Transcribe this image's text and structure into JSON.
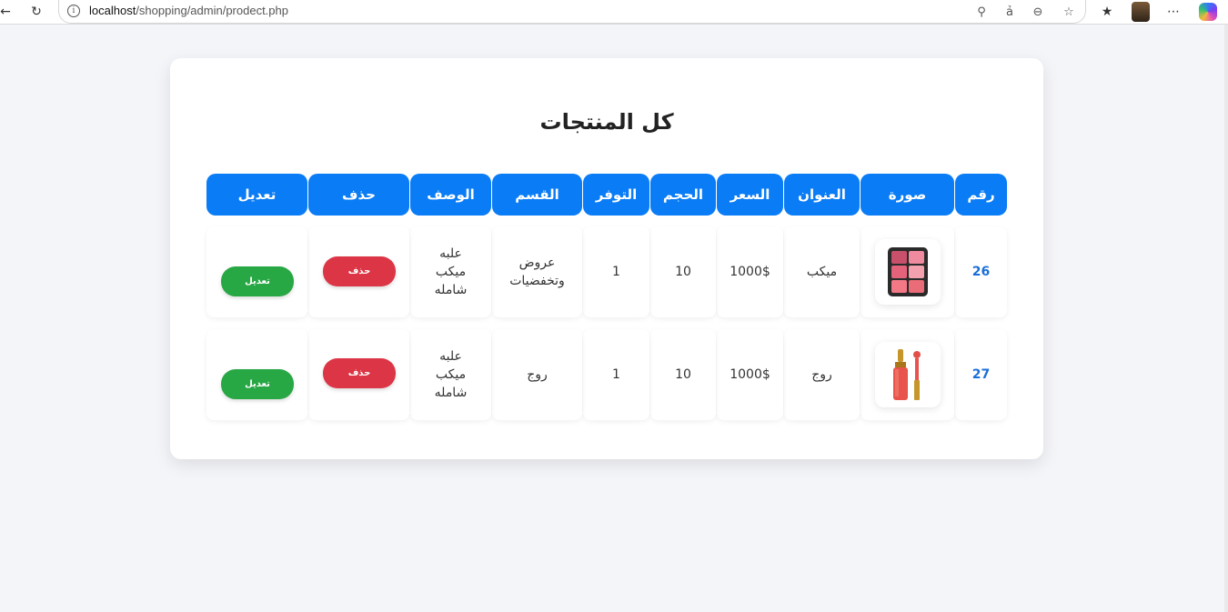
{
  "browser": {
    "url_host": "localhost",
    "url_path": "/shopping/admin/prodect.php"
  },
  "page": {
    "title": "كل المنتجات"
  },
  "table": {
    "headers": [
      "رقم",
      "صورة",
      "العنوان",
      "السعر",
      "الحجم",
      "التوفر",
      "القسم",
      "الوصف",
      "حذف",
      "تعديل"
    ],
    "rows": [
      {
        "id": "26",
        "image": "makeup-palette",
        "title": "ميكب",
        "price": "1000$",
        "size": "10",
        "availability": "1",
        "category": "عروض وتخفضيات",
        "description": "علبه ميكب شامله",
        "delete_label": "حذف",
        "edit_label": "تعديل"
      },
      {
        "id": "27",
        "image": "lipstick",
        "title": "روج",
        "price": "1000$",
        "size": "10",
        "availability": "1",
        "category": "روج",
        "description": "علبه ميكب شامله",
        "delete_label": "حذف",
        "edit_label": "تعديل"
      }
    ]
  },
  "colors": {
    "header": "#0a7cf5",
    "delete": "#dc3545",
    "edit": "#28a745",
    "id_text": "#1a6fd8"
  }
}
